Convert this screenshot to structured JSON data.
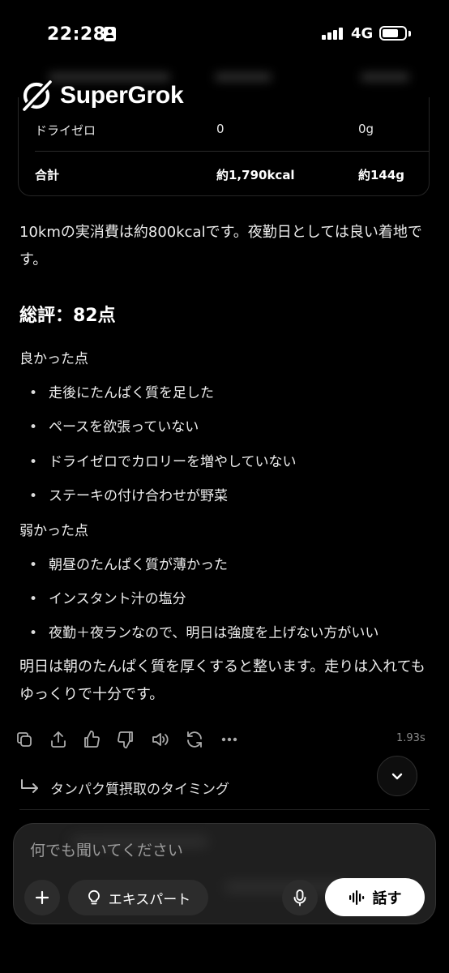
{
  "status_bar": {
    "time": "22:28",
    "network": "4G"
  },
  "app": {
    "name": "SuperGrok"
  },
  "table": {
    "rows": [
      {
        "item": "ドライゼロ",
        "kcal": "0",
        "protein": "0g"
      }
    ],
    "total": {
      "item": "合計",
      "kcal": "約1,790kcal",
      "protein": "約144g"
    }
  },
  "response": {
    "intro": "10kmの実消費は約800kcalです。夜勤日としては良い着地です。",
    "score_heading": "総評：82点",
    "good_label": "良かった点",
    "good_points": [
      "走後にたんぱく質を足した",
      "ペースを欲張っていない",
      "ドライゼロでカロリーを増やしていない",
      "ステーキの付け合わせが野菜"
    ],
    "weak_label": "弱かった点",
    "weak_points": [
      "朝昼のたんぱく質が薄かった",
      "インスタント汁の塩分",
      "夜勤＋夜ランなので、明日は強度を上げない方がいい"
    ],
    "closing": "明日は朝のたんぱく質を厚くすると整います。走りは入れてもゆっくりで十分です。"
  },
  "actions": {
    "icons": [
      "copy-icon",
      "share-icon",
      "thumbs-up-icon",
      "thumbs-down-icon",
      "speaker-icon",
      "regenerate-icon",
      "more-icon"
    ],
    "elapsed": "1.93s"
  },
  "followup": {
    "label": "タンパク質摂取のタイミング"
  },
  "composer": {
    "placeholder": "何でも聞いてください",
    "expert_label": "エキスパート",
    "speak_label": "話す"
  }
}
